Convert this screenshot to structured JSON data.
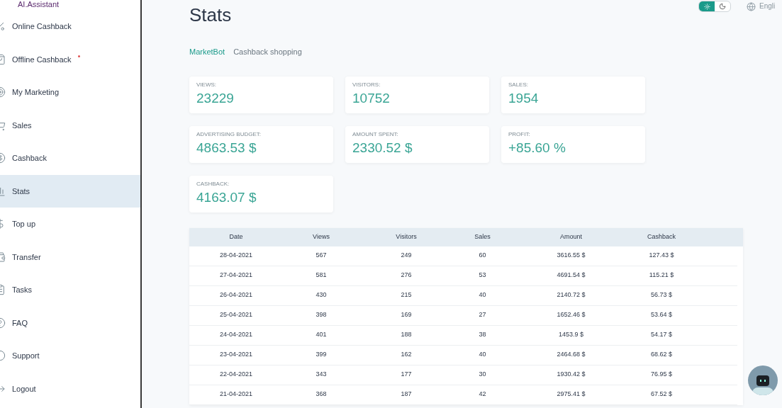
{
  "sidebar": {
    "brand": "AI.Assistant",
    "items": [
      {
        "label": "Online Cashback",
        "selected": false,
        "badge": false
      },
      {
        "label": "Offline Cashback",
        "selected": false,
        "badge": true
      },
      {
        "label": "My Marketing",
        "selected": false,
        "badge": false
      },
      {
        "label": "Sales",
        "selected": false,
        "badge": false
      },
      {
        "label": "Cashback",
        "selected": false,
        "badge": false
      },
      {
        "label": "Stats",
        "selected": true,
        "badge": false
      },
      {
        "label": "Top up",
        "selected": false,
        "badge": false
      },
      {
        "label": "Transfer",
        "selected": false,
        "badge": false
      },
      {
        "label": "Tasks",
        "selected": false,
        "badge": false
      },
      {
        "label": "FAQ",
        "selected": false,
        "badge": false
      },
      {
        "label": "Support",
        "selected": false,
        "badge": false
      },
      {
        "label": "Logout",
        "selected": false,
        "badge": false
      }
    ]
  },
  "header": {
    "title": "Stats",
    "theme": {
      "light_selected": true
    },
    "language": "Engli"
  },
  "tabs": [
    {
      "label": "MarketBot",
      "selected": true
    },
    {
      "label": "Cashback shopping",
      "selected": false
    }
  ],
  "cards": [
    {
      "label": "VIEWS:",
      "value": "23229"
    },
    {
      "label": "VISITORS:",
      "value": "10752"
    },
    {
      "label": "SALES:",
      "value": "1954"
    },
    {
      "label": "ADVERTISING BUDGET:",
      "value": "4863.53 $"
    },
    {
      "label": "AMOUNT SPENT:",
      "value": "2330.52 $"
    },
    {
      "label": "PROFIT:",
      "value": "+85.60 %"
    },
    {
      "label": "CASHBACK:",
      "value": "4163.07 $"
    }
  ],
  "table": {
    "columns": [
      "Date",
      "Views",
      "Visitors",
      "Sales",
      "Amount",
      "Cashback"
    ],
    "rows": [
      [
        "28-04-2021",
        "567",
        "249",
        "60",
        "3616.55 $",
        "127.43 $"
      ],
      [
        "27-04-2021",
        "581",
        "276",
        "53",
        "4691.54 $",
        "115.21 $"
      ],
      [
        "26-04-2021",
        "430",
        "215",
        "40",
        "2140.72 $",
        "56.73 $"
      ],
      [
        "25-04-2021",
        "398",
        "169",
        "27",
        "1652.46 $",
        "53.64 $"
      ],
      [
        "24-04-2021",
        "401",
        "188",
        "38",
        "1453.9 $",
        "54.17 $"
      ],
      [
        "23-04-2021",
        "399",
        "162",
        "40",
        "2464.68 $",
        "68.62 $"
      ],
      [
        "22-04-2021",
        "343",
        "177",
        "30",
        "1930.42 $",
        "76.95 $"
      ],
      [
        "21-04-2021",
        "368",
        "187",
        "42",
        "2975.41 $",
        "67.52 $"
      ]
    ]
  }
}
